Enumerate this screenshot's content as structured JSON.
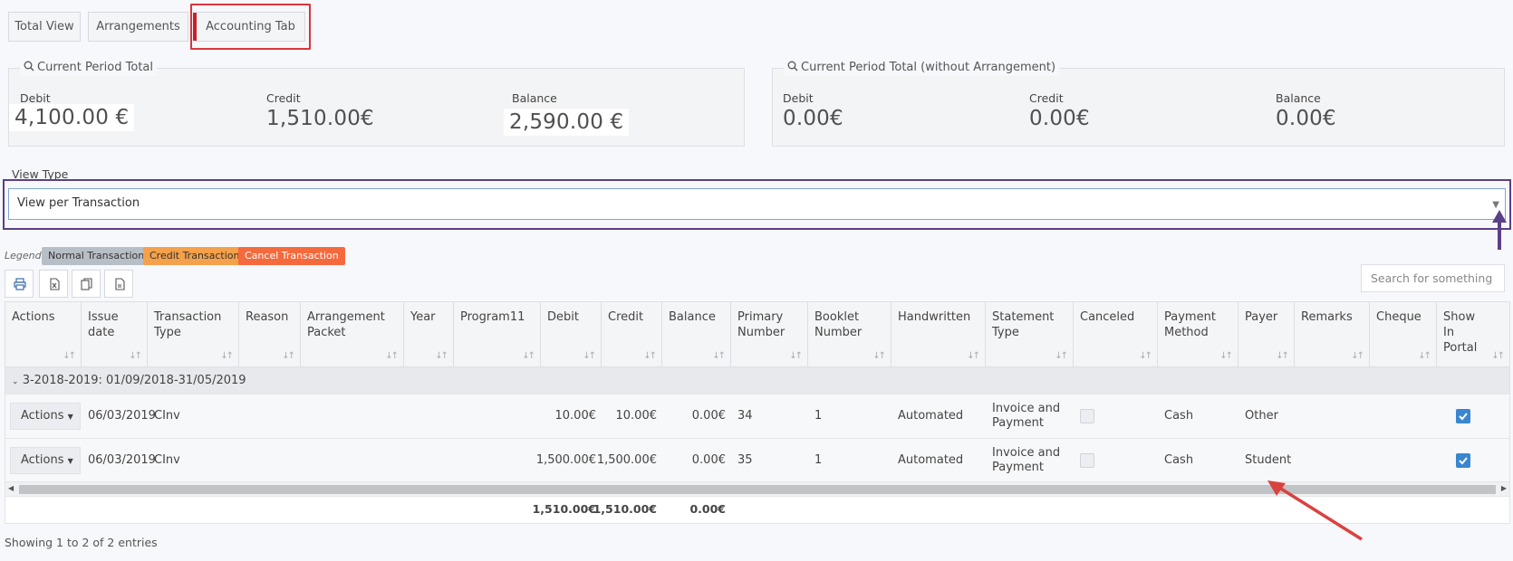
{
  "tabs": [
    {
      "label": "Total View"
    },
    {
      "label": "Arrangements"
    },
    {
      "label": "Accounting Tab"
    }
  ],
  "panels": {
    "current": {
      "title": "Current Period Total",
      "debit_label": "Debit",
      "debit_value": "4,100.00 €",
      "credit_label": "Credit",
      "credit_value": "1,510.00€",
      "balance_label": "Balance",
      "balance_value": "2,590.00 €"
    },
    "without": {
      "title": "Current Period Total (without Arrangement)",
      "debit_label": "Debit",
      "debit_value": "0.00€",
      "credit_label": "Credit",
      "credit_value": "0.00€",
      "balance_label": "Balance",
      "balance_value": "0.00€"
    }
  },
  "view_type": {
    "label": "View Type",
    "selected": "View per Transaction"
  },
  "legend": {
    "label": "Legend:",
    "items": [
      {
        "label": "Normal Transaction",
        "color": "#b8bec6",
        "text_color": "#333333"
      },
      {
        "label": "Credit Transaction",
        "color": "#f5a04a",
        "text_color": "#333333"
      },
      {
        "label": "Cancel Transaction",
        "color": "#f56a3c",
        "text_color": "#ffffff"
      }
    ]
  },
  "toolbar": {
    "icons": [
      "print-icon",
      "excel-icon",
      "copy-icon",
      "csv-icon"
    ],
    "search_placeholder": "Search for something"
  },
  "table": {
    "columns": [
      "Actions",
      "Issue date",
      "Transaction Type",
      "Reason",
      "Arrangement Packet",
      "Year",
      "Program11",
      "Debit",
      "Credit",
      "Balance",
      "Primary Number",
      "Booklet Number",
      "Handwritten",
      "Statement Type",
      "Canceled",
      "Payment Method",
      "Payer",
      "Remarks",
      "Cheque",
      "Show In Portal"
    ],
    "group_label": "3-2018-2019: 01/09/2018-31/05/2019",
    "rows": [
      {
        "action": "Actions",
        "issue_date": "06/03/2019",
        "type": "CInv",
        "debit": "10.00€",
        "credit": "10.00€",
        "balance": "0.00€",
        "primary": "34",
        "booklet": "1",
        "handwritten": "Automated",
        "statement": "Invoice and Payment",
        "canceled": false,
        "method": "Cash",
        "payer": "Other",
        "portal": true
      },
      {
        "action": "Actions",
        "issue_date": "06/03/2019",
        "type": "CInv",
        "debit": "1,500.00€",
        "credit": "1,500.00€",
        "balance": "0.00€",
        "primary": "35",
        "booklet": "1",
        "handwritten": "Automated",
        "statement": "Invoice and Payment",
        "canceled": false,
        "method": "Cash",
        "payer": "Student",
        "portal": true
      }
    ],
    "totals": {
      "debit": "1,510.00€",
      "credit": "1,510.00€",
      "balance": "0.00€"
    }
  },
  "showing": "Showing 1 to 2 of 2 entries",
  "colors": {
    "tab_highlight": "#d9363e",
    "select_highlight": "#5b3f87",
    "arrow": "#d8433f"
  }
}
